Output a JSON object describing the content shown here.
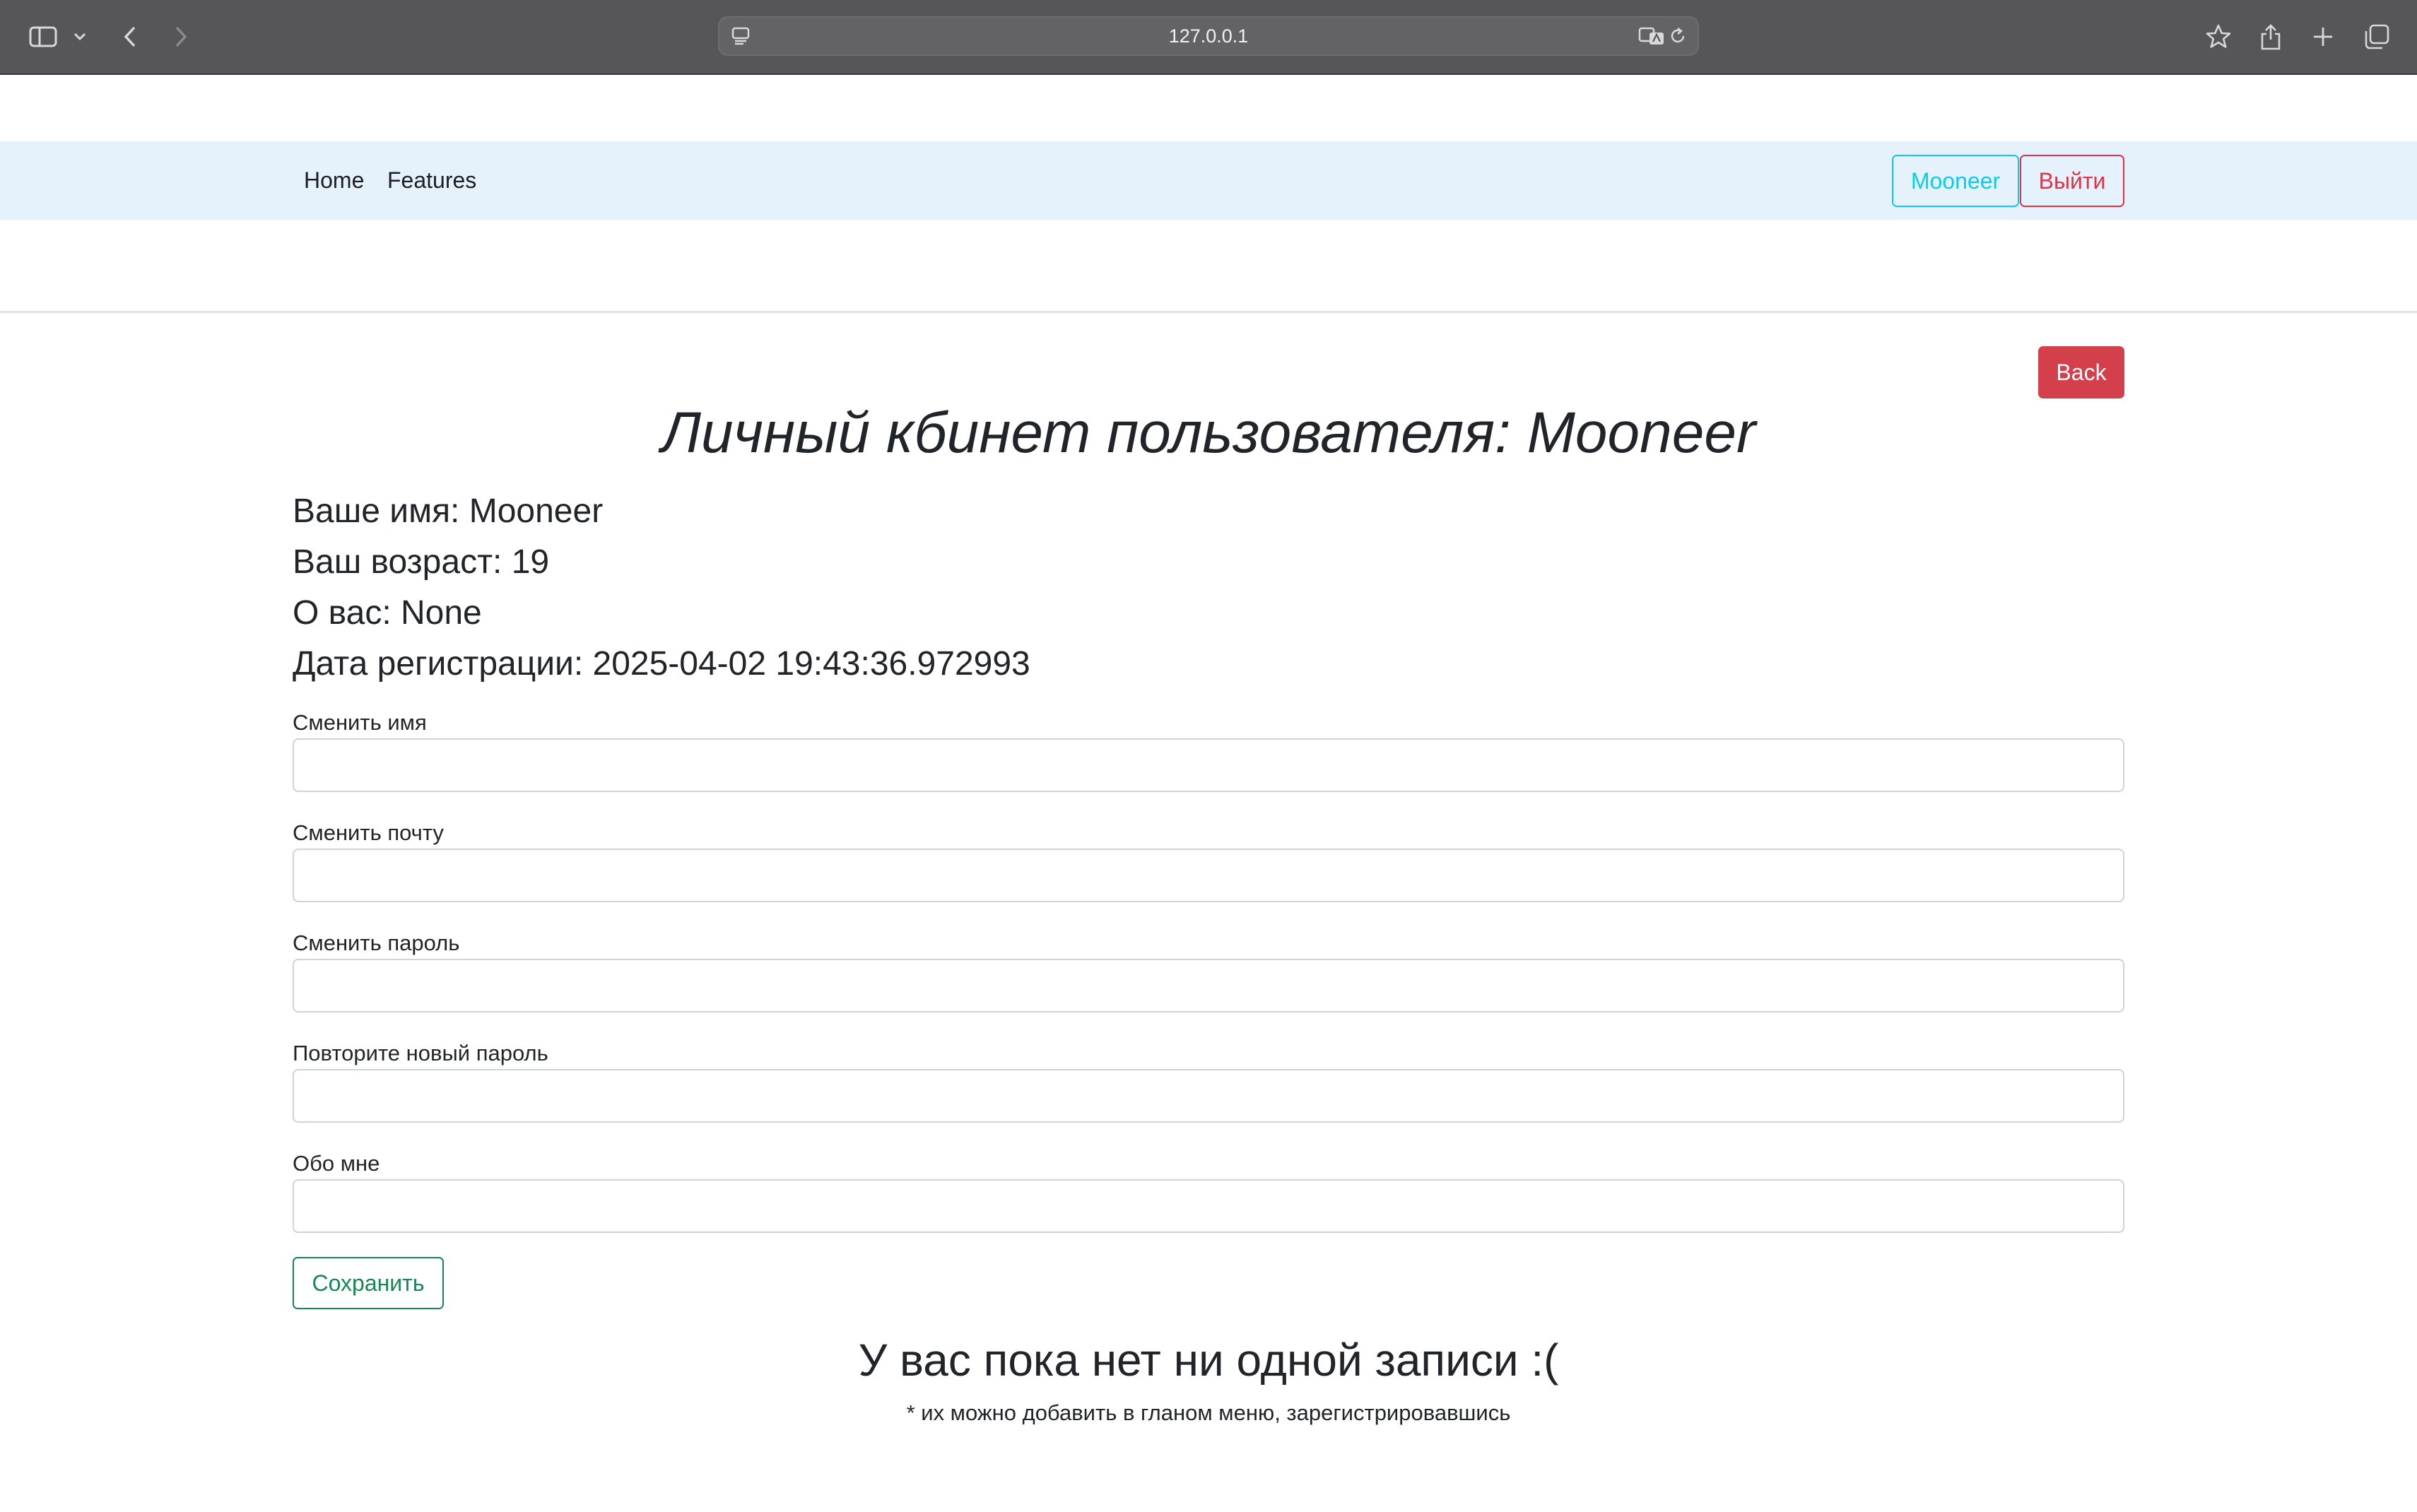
{
  "browser": {
    "url": "127.0.0.1"
  },
  "navbar": {
    "links": [
      "Home",
      "Features"
    ],
    "user_label": "Mooneer",
    "logout_label": "Выйти"
  },
  "back_label": "Back",
  "profile": {
    "title": "Личный кбинет пользователя: Mooneer",
    "name_line": "Ваше имя: Mooneer",
    "age_line": "Ваш возраст: 19",
    "about_line": "О вас: None",
    "registered_line": "Дата регистрации: 2025-04-02 19:43:36.972993"
  },
  "form": {
    "fields": [
      {
        "label": "Сменить имя",
        "value": ""
      },
      {
        "label": "Сменить почту",
        "value": ""
      },
      {
        "label": "Сменить пароль",
        "value": ""
      },
      {
        "label": "Повторите новый пароль",
        "value": ""
      },
      {
        "label": "Обо мне",
        "value": ""
      }
    ],
    "save_label": "Сохранить"
  },
  "records": {
    "empty_title": "У вас пока нет ни одной записи :(",
    "empty_hint": "* их можно добавить в гланом меню, зарегистрировавшись"
  }
}
